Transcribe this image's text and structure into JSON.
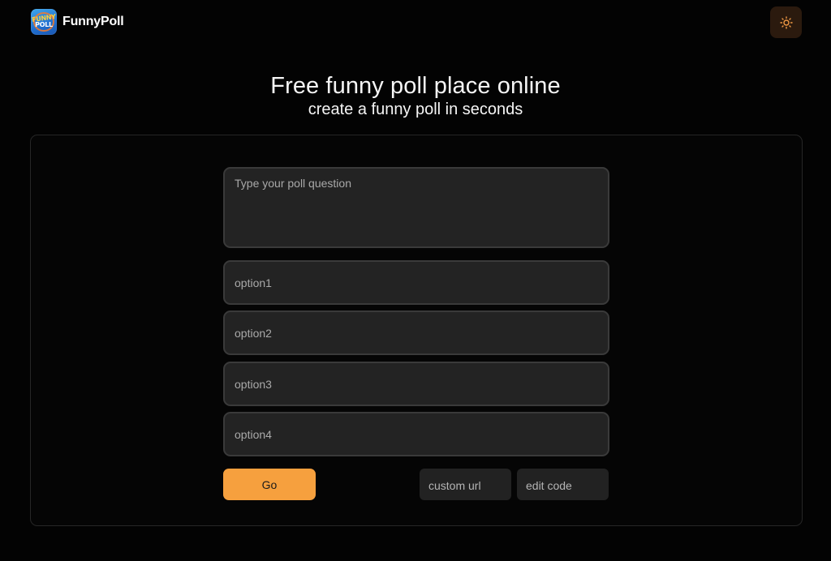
{
  "header": {
    "brand_name": "FunnyPoll",
    "logo_text_top": "FUNNY",
    "logo_text_bottom": "POLL",
    "theme_toggle_icon": "sun-icon",
    "accent_color": "#f6a03e"
  },
  "hero": {
    "title": "Free funny poll place online",
    "subtitle": "create a funny poll in seconds"
  },
  "form": {
    "question_placeholder": "Type your poll question",
    "options": [
      {
        "placeholder": "option1"
      },
      {
        "placeholder": "option2"
      },
      {
        "placeholder": "option3"
      },
      {
        "placeholder": "option4"
      }
    ],
    "submit_label": "Go",
    "custom_url_placeholder": "custom url",
    "edit_code_placeholder": "edit code"
  }
}
